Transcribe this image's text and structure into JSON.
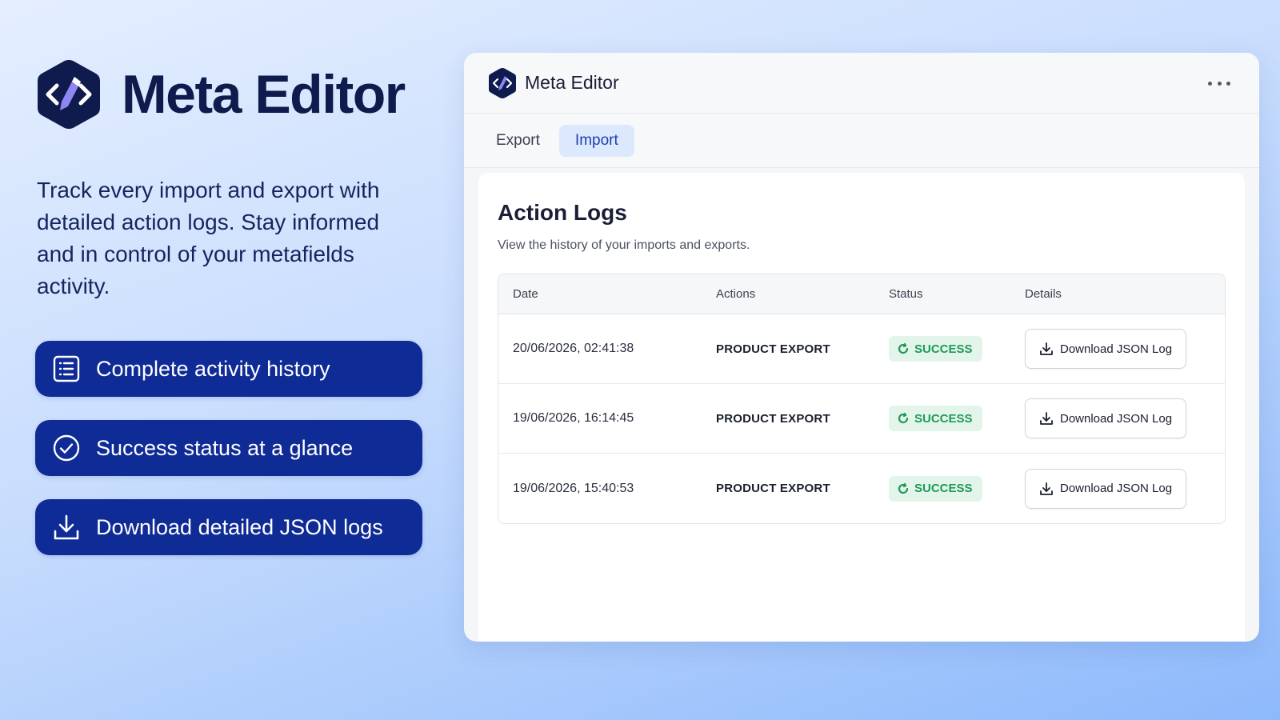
{
  "hero": {
    "title": "Meta Editor",
    "description": "Track every import and export with detailed action logs. Stay informed and in control of your metafields activity.",
    "features": [
      {
        "label": "Complete activity history",
        "icon": "list-icon"
      },
      {
        "label": "Success status at a glance",
        "icon": "check-circle-icon"
      },
      {
        "label": "Download detailed JSON logs",
        "icon": "download-icon"
      }
    ]
  },
  "app": {
    "name": "Meta Editor",
    "tabs": [
      {
        "label": "Export",
        "active": false
      },
      {
        "label": "Import",
        "active": true
      }
    ],
    "card": {
      "title": "Action Logs",
      "subtitle": "View the history of your imports and exports.",
      "columns": [
        "Date",
        "Actions",
        "Status",
        "Details"
      ],
      "rows": [
        {
          "date": "20/06/2026, 02:41:38",
          "action": "PRODUCT EXPORT",
          "status": "SUCCESS",
          "details": "Download JSON Log"
        },
        {
          "date": "19/06/2026, 16:14:45",
          "action": "PRODUCT EXPORT",
          "status": "SUCCESS",
          "details": "Download JSON Log"
        },
        {
          "date": "19/06/2026, 15:40:53",
          "action": "PRODUCT EXPORT",
          "status": "SUCCESS",
          "details": "Download JSON Log"
        }
      ]
    }
  },
  "colors": {
    "brand_navy": "#0f1a4d",
    "feature_bg": "#0f2b96",
    "active_tab_bg": "#dce9fd",
    "success_bg": "#e3f5ea",
    "success_text": "#1f9a56"
  }
}
